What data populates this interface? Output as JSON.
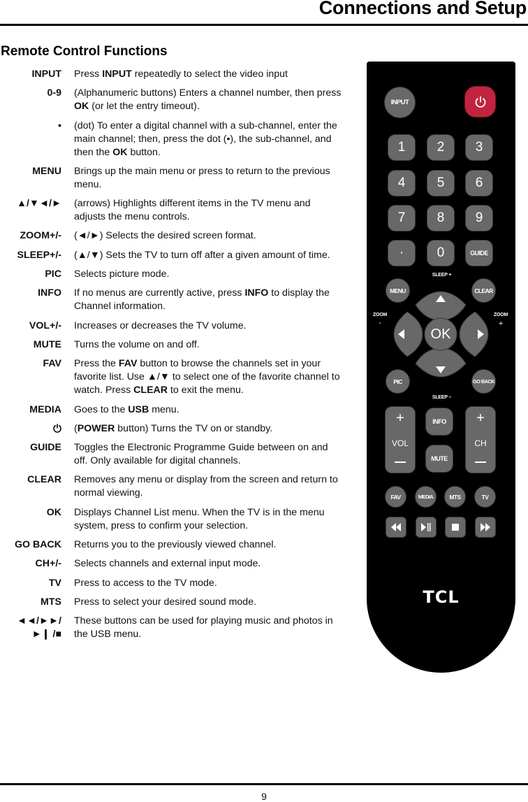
{
  "header": {
    "title": "Connections and Setup"
  },
  "section": {
    "title": "Remote Control Functions"
  },
  "functions": [
    {
      "key": "INPUT",
      "desc": [
        {
          "t": "Press "
        },
        {
          "b": "INPUT"
        },
        {
          "t": " repeatedly to select the video input"
        }
      ]
    },
    {
      "key": "0-9",
      "desc": [
        {
          "t": "(Alphanumeric buttons) Enters a channel number, then press "
        },
        {
          "b": "OK"
        },
        {
          "t": " (or let the entry timeout)."
        }
      ]
    },
    {
      "key": "•",
      "desc": [
        {
          "t": "(dot) To enter a digital channel with a sub-channel, enter the main channel; then, press the dot (•), the sub-channel, and then the "
        },
        {
          "b": "OK"
        },
        {
          "t": " button."
        }
      ]
    },
    {
      "key": "MENU",
      "desc": [
        {
          "t": "Brings up the main menu or press to return to the previous menu."
        }
      ]
    },
    {
      "key": "▲/▼◄/►",
      "desc": [
        {
          "t": "(arrows) Highlights different items in the TV menu and adjusts the menu controls."
        }
      ]
    },
    {
      "key": "ZOOM+/-",
      "desc": [
        {
          "t": "(◄/►) Selects the desired screen format."
        }
      ]
    },
    {
      "key": "SLEEP+/-",
      "desc": [
        {
          "t": "(▲/▼) Sets the TV to turn off after a given amount of time."
        }
      ]
    },
    {
      "key": "PIC",
      "desc": [
        {
          "t": "Selects picture mode."
        }
      ]
    },
    {
      "key": "INFO",
      "desc": [
        {
          "t": "If no menus are currently active, press "
        },
        {
          "b": "INFO"
        },
        {
          "t": " to display the Channel information."
        }
      ]
    },
    {
      "key": "VOL+/-",
      "desc": [
        {
          "t": "Increases or decreases the TV volume."
        }
      ]
    },
    {
      "key": "MUTE",
      "desc": [
        {
          "t": "Turns the volume on and off."
        }
      ]
    },
    {
      "key": "FAV",
      "desc": [
        {
          "t": "Press the "
        },
        {
          "b": "FAV"
        },
        {
          "t": " button to browse the channels set in your favorite list. Use ▲/▼ to select one of the favorite channel to watch. Press "
        },
        {
          "b": "CLEAR"
        },
        {
          "t": " to exit the menu."
        }
      ]
    },
    {
      "key": "MEDIA",
      "desc": [
        {
          "t": "Goes to the "
        },
        {
          "b": "USB"
        },
        {
          "t": " menu."
        }
      ]
    },
    {
      "key": "⏻",
      "desc": [
        {
          "t": "("
        },
        {
          "b": "POWER"
        },
        {
          "t": " button) Turns the TV on or standby."
        }
      ]
    },
    {
      "key": "GUIDE",
      "desc": [
        {
          "t": "Toggles the Electronic Programme Guide between on and off. Only available for digital channels."
        }
      ]
    },
    {
      "key": "CLEAR",
      "desc": [
        {
          "t": "Removes any menu or display from the screen and return to normal viewing."
        }
      ]
    },
    {
      "key": "OK",
      "desc": [
        {
          "t": "Displays Channel List menu. When the TV is in the menu system, press to confirm your selection."
        }
      ]
    },
    {
      "key": "GO BACK",
      "desc": [
        {
          "t": "Returns you to the previously viewed channel."
        }
      ]
    },
    {
      "key": "CH+/-",
      "desc": [
        {
          "t": "Selects channels and external input mode."
        }
      ]
    },
    {
      "key": "TV",
      "desc": [
        {
          "t": "Press to access to the TV mode."
        }
      ]
    },
    {
      "key": "MTS",
      "desc": [
        {
          "t": "Press to select your desired sound mode."
        }
      ]
    },
    {
      "key": "◄◄/►►/►❙ /■",
      "desc": [
        {
          "t": "These buttons can be used for playing music and photos in the USB menu."
        }
      ]
    }
  ],
  "remote": {
    "input": "INPUT",
    "power_icon": "power-icon",
    "digits": [
      "1",
      "2",
      "3",
      "4",
      "5",
      "6",
      "7",
      "8",
      "9"
    ],
    "dot": "·",
    "zero": "0",
    "guide": "GUIDE",
    "sleep_plus": "SLEEP  +",
    "sleep_minus": "SLEEP  –",
    "menu": "MENU",
    "clear": "CLEAR",
    "zoom_minus_label": "ZOOM",
    "zoom_minus_sign": "-",
    "zoom_plus_label": "ZOOM",
    "zoom_plus_sign": "+",
    "ok": "OK",
    "pic": "PIC",
    "go_back": "GO BACK",
    "vol": "VOL",
    "ch": "CH",
    "info": "INFO",
    "mute": "MUTE",
    "fav": "FAV",
    "media": "MEDIA",
    "mts": "MTS",
    "tv": "TV",
    "brand": "TCL",
    "colors": {
      "body": "#000000",
      "button": "#686868",
      "power": "#c0243f"
    }
  },
  "footer": {
    "page_number": "9"
  }
}
